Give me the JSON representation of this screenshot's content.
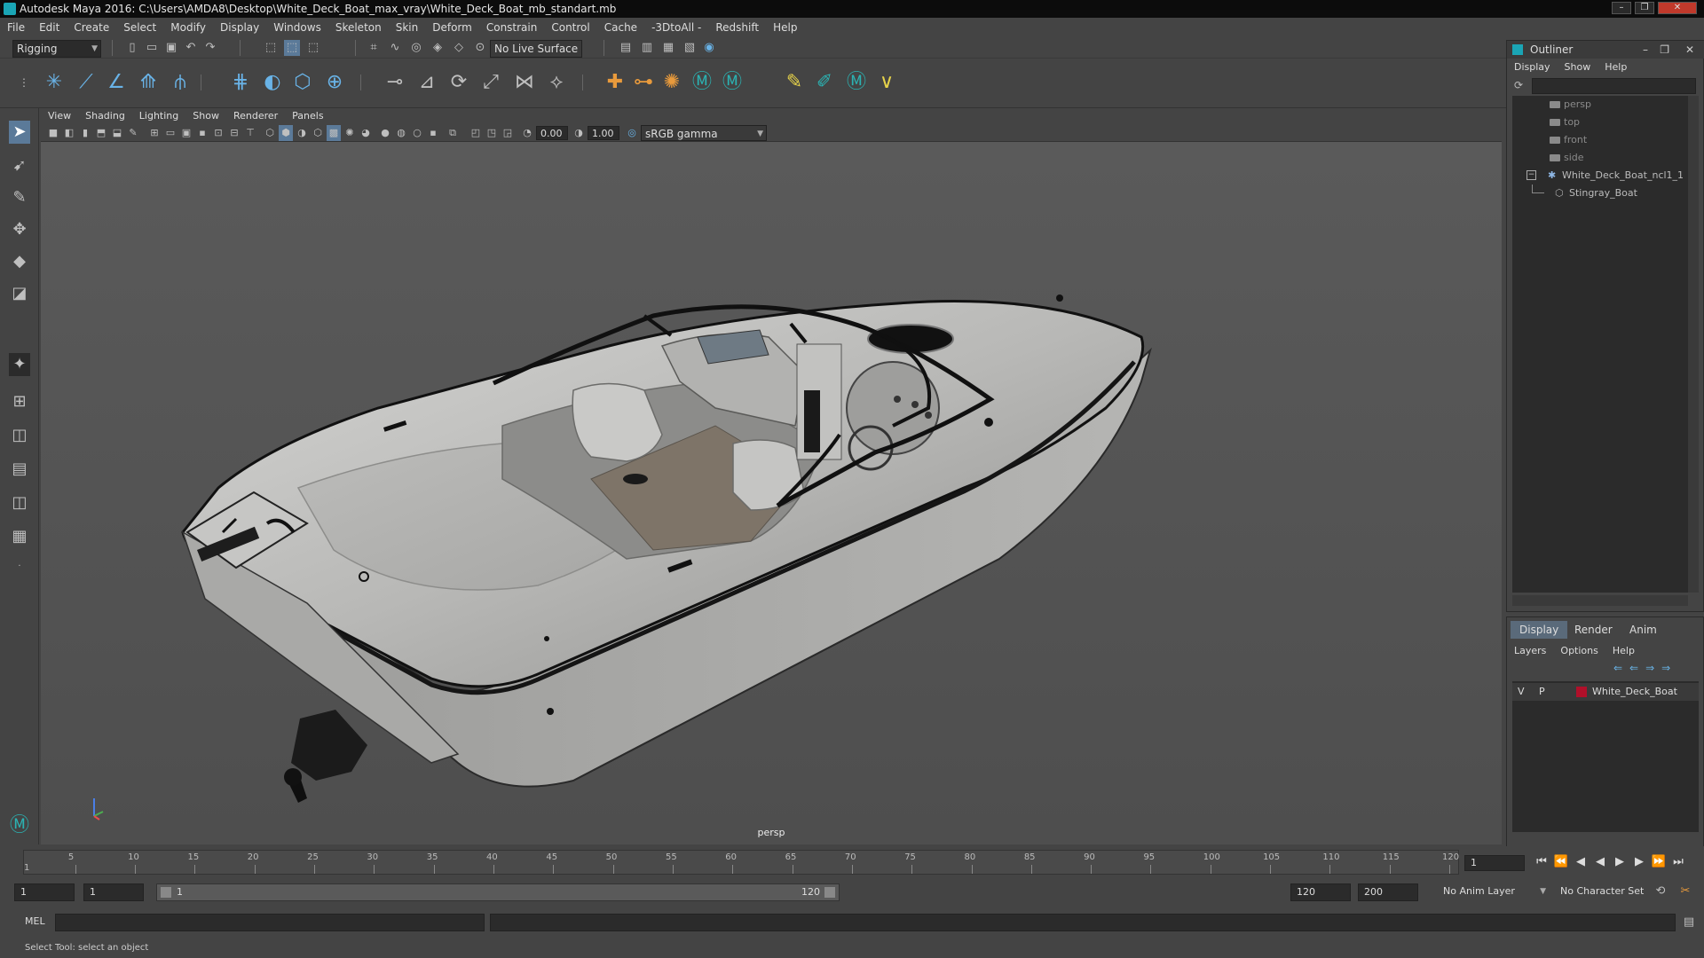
{
  "window": {
    "title": "Autodesk Maya 2016: C:\\Users\\AMDA8\\Desktop\\White_Deck_Boat_max_vray\\White_Deck_Boat_mb_standart.mb",
    "controls": [
      "–",
      "❐",
      "✕"
    ]
  },
  "menubar": [
    "File",
    "Edit",
    "Create",
    "Select",
    "Modify",
    "Display",
    "Windows",
    "Skeleton",
    "Skin",
    "Deform",
    "Constrain",
    "Control",
    "Cache",
    "-3DtoAll -",
    "Redshift",
    "Help"
  ],
  "statusline": {
    "menuset": "Rigging",
    "live_surface": "No Live Surface"
  },
  "viewport": {
    "menus": [
      "View",
      "Shading",
      "Lighting",
      "Show",
      "Renderer",
      "Panels"
    ],
    "exposure": "0.00",
    "gamma": "1.00",
    "color_space": "sRGB gamma",
    "camera_label": "persp"
  },
  "outliner": {
    "title": "Outliner",
    "menus": [
      "Display",
      "Show",
      "Help"
    ],
    "items": [
      {
        "label": "persp",
        "kind": "camera"
      },
      {
        "label": "top",
        "kind": "camera"
      },
      {
        "label": "front",
        "kind": "camera"
      },
      {
        "label": "side",
        "kind": "camera"
      },
      {
        "label": "White_Deck_Boat_ncl1_1",
        "kind": "group"
      },
      {
        "label": "Stingray_Boat",
        "kind": "mesh"
      }
    ]
  },
  "layers": {
    "tabs": [
      "Display",
      "Render",
      "Anim"
    ],
    "menus": [
      "Layers",
      "Options",
      "Help"
    ],
    "row": {
      "v": "V",
      "p": "P",
      "name": "White_Deck_Boat",
      "color": "#b0102a"
    }
  },
  "timeline": {
    "ticks": [
      "5",
      "10",
      "15",
      "20",
      "25",
      "30",
      "35",
      "40",
      "45",
      "50",
      "55",
      "60",
      "65",
      "70",
      "75",
      "80",
      "85",
      "90",
      "95",
      "100",
      "105",
      "110",
      "115",
      "120"
    ],
    "start_tick": "1",
    "current_frame": "1"
  },
  "range": {
    "start": "1",
    "playback_start": "1",
    "slider_start": "1",
    "slider_end": "120",
    "playback_end": "120",
    "end": "200",
    "anim_layer": "No Anim Layer",
    "character_set": "No Character Set"
  },
  "command_line": {
    "label": "MEL"
  },
  "help_line": "Select Tool: select an object"
}
